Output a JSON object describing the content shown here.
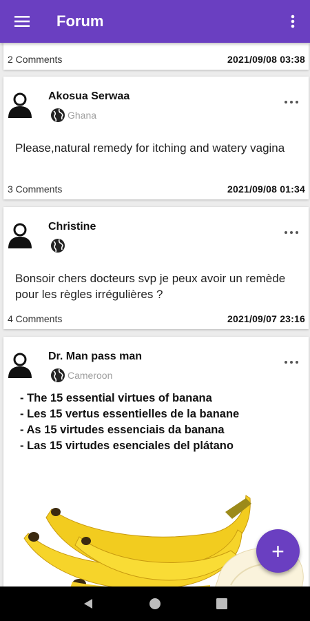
{
  "appbar": {
    "title": "Forum",
    "menu_icon": "hamburger-menu-icon",
    "more_icon": "more-vert-icon"
  },
  "colors": {
    "primary": "#6a3fc1",
    "background": "#ececec"
  },
  "posts": [
    {
      "comments": "2 Comments",
      "date": "2021/09/08 03:38"
    },
    {
      "author": "Akosua Serwaa",
      "location": "Ghana",
      "text": "Please,natural remedy for itching and watery vagina",
      "comments": "3 Comments",
      "date": "2021/09/08 01:34"
    },
    {
      "author": "Christine",
      "location": "",
      "text": "Bonsoir chers docteurs svp je peux avoir un remède pour les règles irrégulières ?",
      "comments": "4 Comments",
      "date": "2021/09/07 23:16"
    },
    {
      "author": "Dr. Man pass man",
      "location": "Cameroon",
      "lines": [
        "- The 15 essential virtues of banana",
        "- Les 15 vertus essentielles de la banane",
        "- As 15 virtudes essenciais da banana",
        "- Las 15 virtudes esenciales del plátano"
      ],
      "image": "banana-image"
    }
  ],
  "fab": {
    "label": "+",
    "icon": "add-icon"
  },
  "navbar": {
    "icons": [
      "back-icon",
      "home-icon",
      "recents-icon"
    ]
  }
}
